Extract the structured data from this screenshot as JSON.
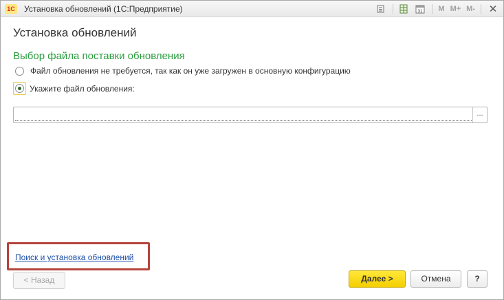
{
  "window": {
    "app_logo": "1С",
    "title": "Установка обновлений  (1С:Предприятие)",
    "toolbar": {
      "icons": [
        "document-icon",
        "spreadsheet-icon",
        "calendar-icon"
      ],
      "calendar_day": "31",
      "memory_labels": [
        "M",
        "M+",
        "M-"
      ],
      "close": "✕"
    }
  },
  "form": {
    "heading": "Установка обновлений",
    "section_title": "Выбор файла поставки обновления",
    "options": [
      {
        "label": "Файл обновления не требуется, так как он уже загружен в основную конфигурацию",
        "selected": false
      },
      {
        "label": "Укажите файл обновления:",
        "selected": true
      }
    ],
    "file_path": {
      "value": "",
      "select_button": "..."
    },
    "link": "Поиск и установка обновлений"
  },
  "buttons": {
    "back": "< Назад",
    "next": "Далее >",
    "cancel": "Отмена",
    "help": "?"
  },
  "colors": {
    "section_title": "#2a9d3e",
    "link": "#1d4fa8",
    "primary_button": "#f4cf00",
    "highlight_box": "#b5443a"
  }
}
